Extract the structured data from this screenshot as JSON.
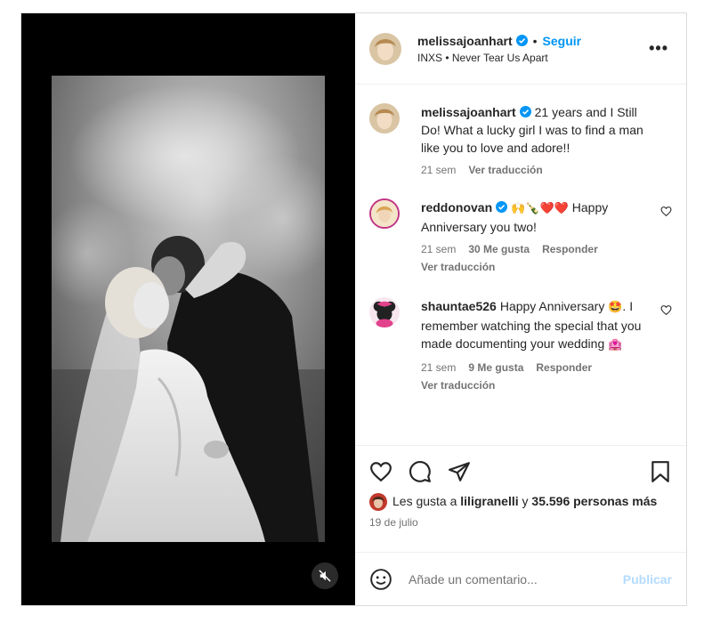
{
  "author": {
    "username": "melissajoanhart",
    "follow_label": "Seguir",
    "separator": "•",
    "audio": "INXS • Never Tear Us Apart",
    "more_label": "•••"
  },
  "caption": {
    "username": "melissajoanhart",
    "text": "21 years and I Still Do! What a lucky girl I was to find a man like you to love and adore!!",
    "time": "21 sem",
    "translate_label": "Ver traducción"
  },
  "comments": [
    {
      "username": "reddonovan",
      "emojis": "🙌🍾❤️❤️",
      "text": "Happy Anniversary you two!",
      "time": "21 sem",
      "likes": "30 Me gusta",
      "reply_label": "Responder",
      "translate_label": "Ver traducción"
    },
    {
      "username": "shauntae526",
      "text_part1": "Happy Anniversary",
      "emoji1": "🤩",
      "text_part2": ". I remember watching the special that you made documenting your wedding",
      "emoji2": "🏩",
      "time": "21 sem",
      "likes": "9 Me gusta",
      "reply_label": "Responder",
      "translate_label": "Ver traducción"
    }
  ],
  "likes_summary": {
    "prefix": "Les gusta a",
    "user": "liligranelli",
    "connector": "y",
    "others": "35.596 personas más"
  },
  "date": "19 de julio",
  "composer": {
    "placeholder": "Añade un comentario...",
    "publish_label": "Publicar"
  },
  "colors": {
    "accent": "#0095f6",
    "verified": "#0095f6",
    "publish_disabled": "#b3dbff",
    "muted_text": "#737373"
  },
  "icons": {
    "like": "heart-icon",
    "comment": "comment-icon",
    "share": "paper-plane-icon",
    "save": "bookmark-icon",
    "audio": "muted-speaker-icon",
    "emoji": "smiley-icon"
  }
}
